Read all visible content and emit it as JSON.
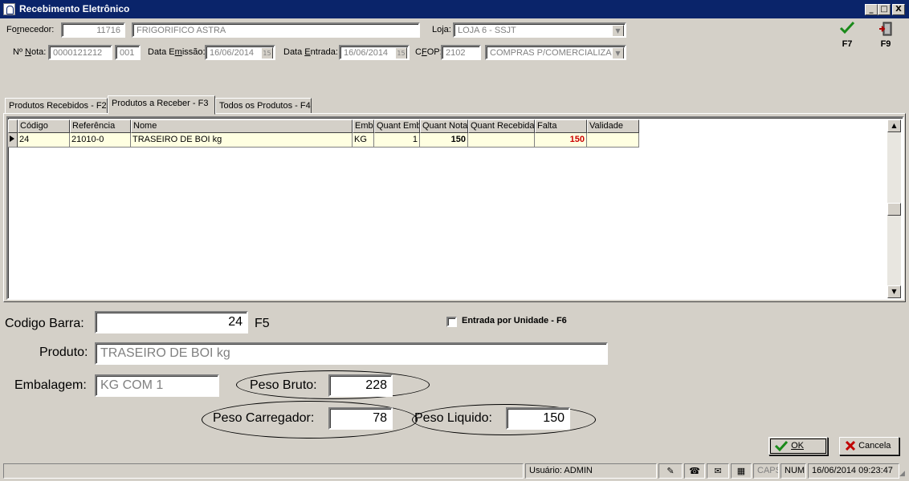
{
  "window": {
    "title": "Recebimento Eletrônico",
    "minimize": "_",
    "maximize": "□",
    "close": "X"
  },
  "header": {
    "fornecedor_label": "Fornecedor:",
    "fornecedor_code": "11716",
    "fornecedor_name": "FRIGORIFICO ASTRA",
    "loja_label": "Loja:",
    "loja_value": "LOJA 6 - SSJT",
    "nota_label": "Nº Nota:",
    "nota_number": "0000121212",
    "nota_serie": "001",
    "data_emissao_label": "Data Emissão:",
    "data_emissao": "16/06/2014",
    "data_entrada_label": "Data Entrada:",
    "data_entrada": "16/06/2014",
    "cfop_label": "CFOP:",
    "cfop_code": "2102",
    "cfop_desc": "COMPRAS P/COMERCIALIZAC",
    "cal_icon_text": "15"
  },
  "toolbar": {
    "confirm_key": "F7",
    "exit_key": "F9"
  },
  "tabs": [
    {
      "label": "Produtos Recebidos - F2"
    },
    {
      "label": "Produtos a Receber  - F3"
    },
    {
      "label": "Todos os Produtos - F4"
    }
  ],
  "grid": {
    "columns": [
      "Código",
      "Referência",
      "Nome",
      "Emb",
      "Quant Emb",
      "Quant Nota",
      "Quant Recebida",
      "Falta",
      "Validade"
    ],
    "rows": [
      {
        "codigo": "24",
        "referencia": "21010-0",
        "nome": "TRASEIRO DE BOI kg",
        "emb": "KG",
        "quant_emb": "1",
        "quant_nota": "150",
        "quant_recebida": "",
        "falta": "150",
        "validade": ""
      }
    ]
  },
  "form": {
    "codigo_barra_label": "Codigo Barra:",
    "codigo_barra": "24",
    "f5": "F5",
    "entrada_unidade_label": "Entrada por Unidade - F6",
    "produto_label": "Produto:",
    "produto": "TRASEIRO DE BOI kg",
    "embalagem_label": "Embalagem:",
    "embalagem": "KG COM 1",
    "peso_bruto_label": "Peso Bruto:",
    "peso_bruto": "228",
    "peso_carregador_label": "Peso Carregador:",
    "peso_carregador": "78",
    "peso_liquido_label": "Peso Liquido:",
    "peso_liquido": "150"
  },
  "buttons": {
    "ok": "OK",
    "cancel": "Cancela"
  },
  "statusbar": {
    "user": "Usuário: ADMIN",
    "caps": "CAPS",
    "num": "NUM",
    "datetime": "16/06/2014 09:23:47"
  },
  "colors": {
    "falta": "#cc0000",
    "titlebar": "#0a246a",
    "row_bg": "#ffffe1"
  }
}
